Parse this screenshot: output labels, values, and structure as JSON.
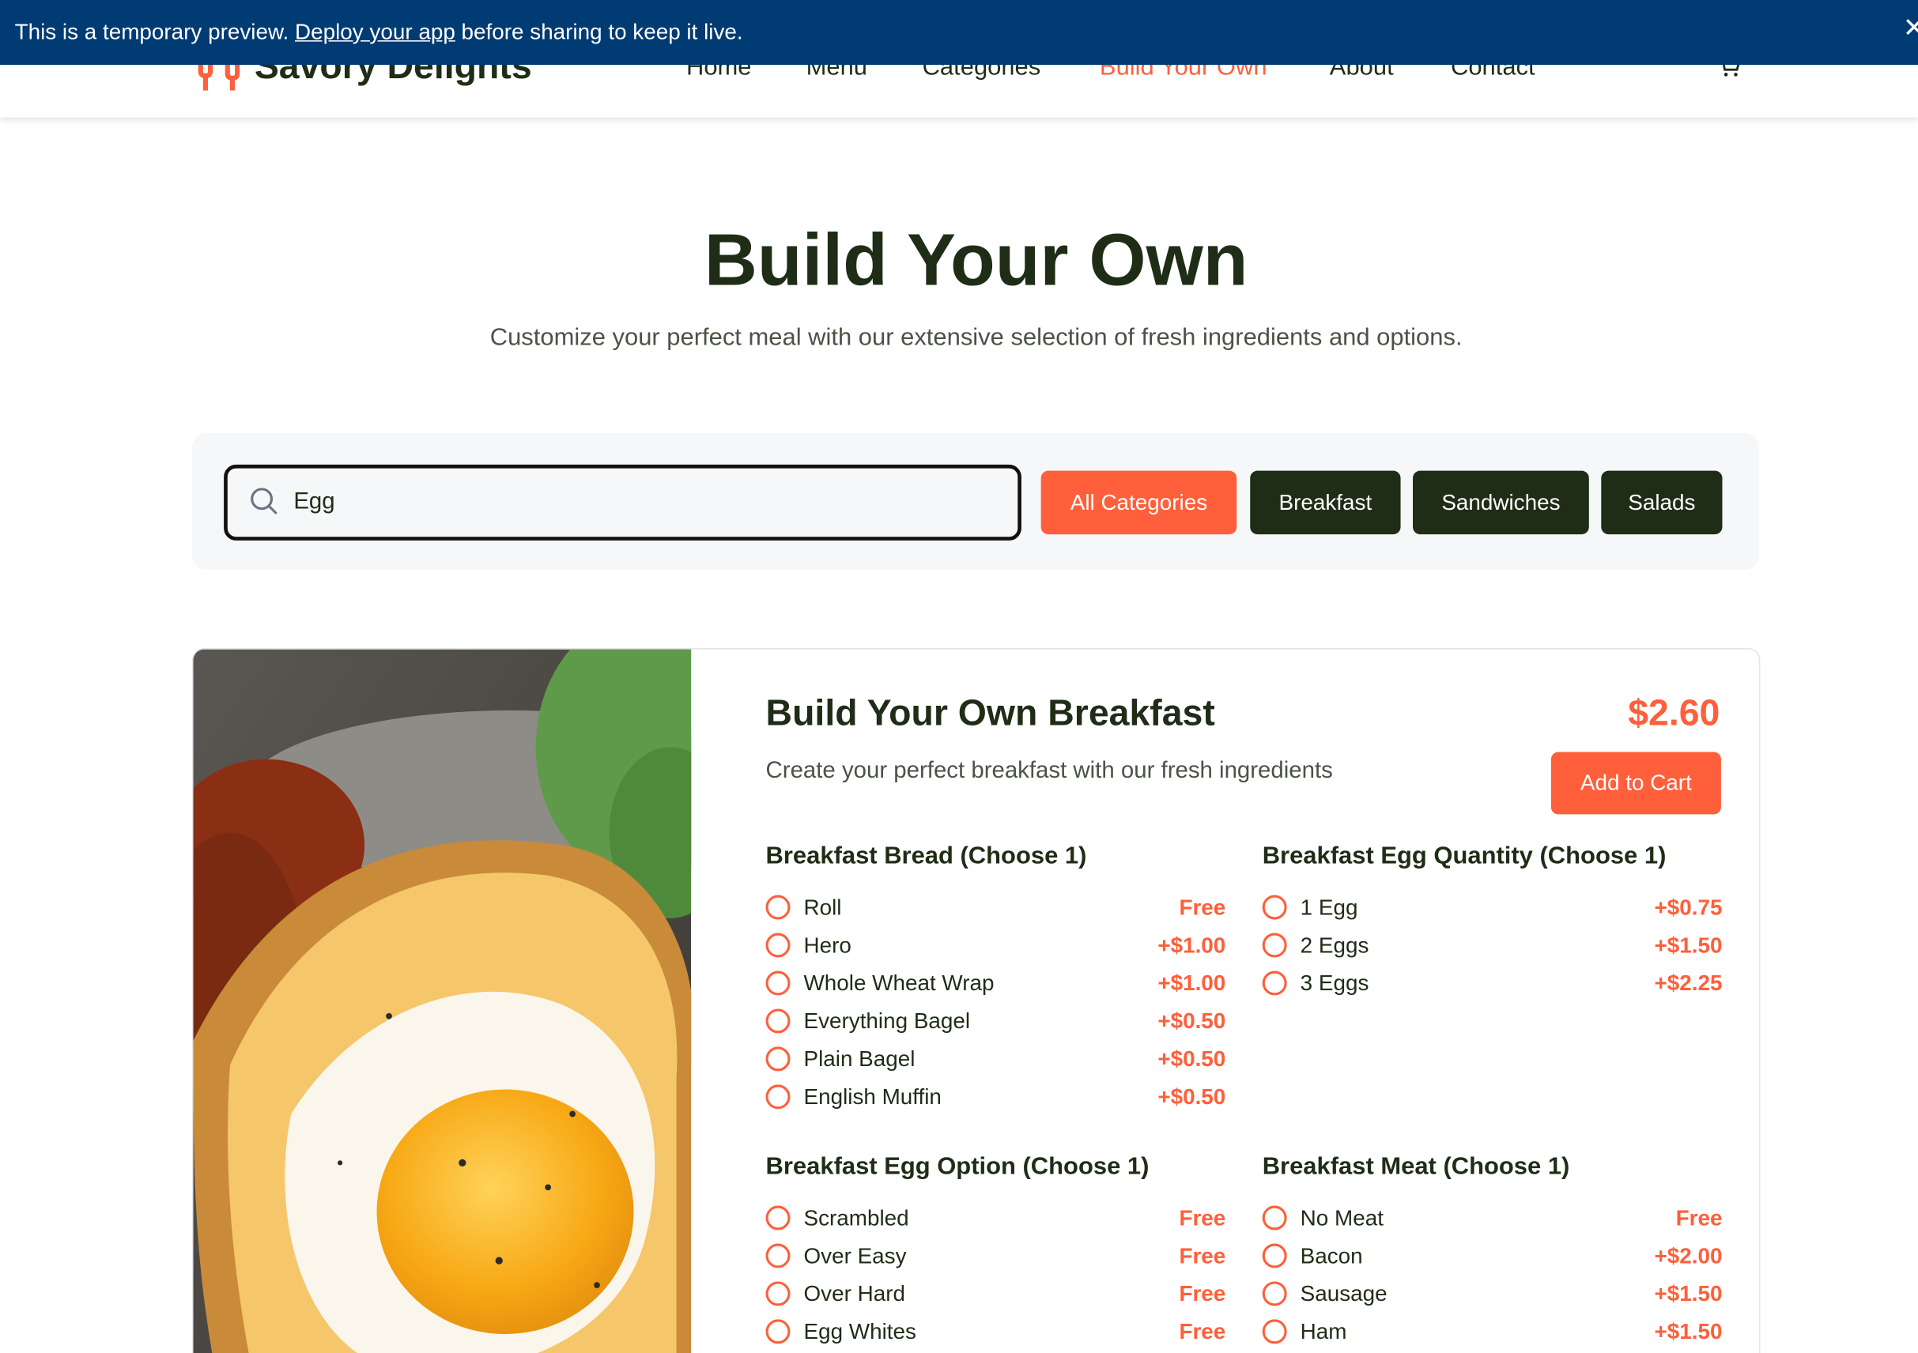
{
  "banner": {
    "text_before": "This is a temporary preview.",
    "link": "Deploy your app",
    "text_after": "before sharing to keep it live.",
    "close": "✕"
  },
  "header": {
    "brand": "Savory Delights",
    "nav": [
      {
        "label": "Home",
        "active": false
      },
      {
        "label": "Menu",
        "active": false
      },
      {
        "label": "Categories",
        "active": false
      },
      {
        "label": "Build Your Own",
        "active": true
      },
      {
        "label": "About",
        "active": false
      },
      {
        "label": "Contact",
        "active": false
      }
    ],
    "cart_icon": "cart-icon"
  },
  "hero": {
    "title": "Build Your Own",
    "subtitle": "Customize your perfect meal with our extensive selection of fresh ingredients and options."
  },
  "filters": {
    "search_value": "Egg",
    "search_icon": "search-icon",
    "categories": [
      "All Categories",
      "Breakfast",
      "Sandwiches",
      "Salads"
    ],
    "active_category": "All Categories"
  },
  "product": {
    "title": "Build Your Own Breakfast",
    "description": "Create your perfect breakfast with our fresh ingredients",
    "price": "$2.60",
    "add_to_cart": "Add to Cart",
    "groups": [
      {
        "title": "Breakfast Bread (Choose 1)",
        "options": [
          {
            "name": "Roll",
            "price": "Free"
          },
          {
            "name": "Hero",
            "price": "+$1.00"
          },
          {
            "name": "Whole Wheat Wrap",
            "price": "+$1.00"
          },
          {
            "name": "Everything Bagel",
            "price": "+$0.50"
          },
          {
            "name": "Plain Bagel",
            "price": "+$0.50"
          },
          {
            "name": "English Muffin",
            "price": "+$0.50"
          }
        ]
      },
      {
        "title": "Breakfast Egg Quantity (Choose 1)",
        "options": [
          {
            "name": "1 Egg",
            "price": "+$0.75"
          },
          {
            "name": "2 Eggs",
            "price": "+$1.50"
          },
          {
            "name": "3 Eggs",
            "price": "+$2.25"
          }
        ]
      },
      {
        "title": "Breakfast Egg Option (Choose 1)",
        "options": [
          {
            "name": "Scrambled",
            "price": "Free"
          },
          {
            "name": "Over Easy",
            "price": "Free"
          },
          {
            "name": "Over Hard",
            "price": "Free"
          },
          {
            "name": "Egg Whites",
            "price": "Free"
          }
        ]
      },
      {
        "title": "Breakfast Meat (Choose 1)",
        "options": [
          {
            "name": "No Meat",
            "price": "Free"
          },
          {
            "name": "Bacon",
            "price": "+$2.00"
          },
          {
            "name": "Sausage",
            "price": "+$1.50"
          },
          {
            "name": "Ham",
            "price": "+$1.50"
          }
        ]
      }
    ]
  },
  "colors": {
    "accent": "#ff5f3a",
    "dark_green": "#1f2d16",
    "banner_blue": "#003b73"
  }
}
